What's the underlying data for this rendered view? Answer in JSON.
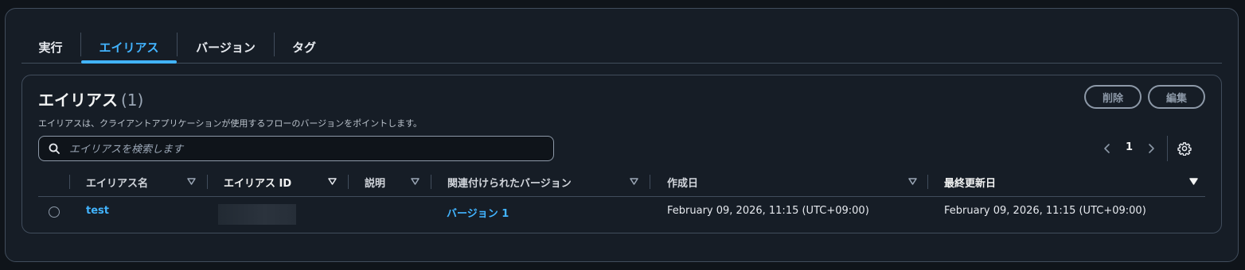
{
  "tabs": [
    {
      "label": "実行",
      "active": false
    },
    {
      "label": "エイリアス",
      "active": true
    },
    {
      "label": "バージョン",
      "active": false
    },
    {
      "label": "タグ",
      "active": false
    }
  ],
  "panel": {
    "title": "エイリアス",
    "count": "(1)",
    "description": "エイリアスは、クライアントアプリケーションが使用するフローのバージョンをポイントします。",
    "delete_label": "削除",
    "edit_label": "編集"
  },
  "search": {
    "placeholder": "エイリアスを検索します",
    "value": ""
  },
  "pagination": {
    "current_page": "1"
  },
  "table": {
    "columns": [
      "エイリアス名",
      "エイリアス ID",
      "説明",
      "関連付けられたバージョン",
      "作成日",
      "最終更新日"
    ],
    "rows": [
      {
        "name": "test",
        "alias_id": "",
        "description": "",
        "version": "バージョン 1",
        "created": "February 09, 2026, 11:15 (UTC+09:00)",
        "updated": "February 09, 2026, 11:15 (UTC+09:00)"
      }
    ]
  },
  "colors": {
    "accent": "#42b4ff",
    "background": "#0f141a",
    "panel": "#161d26",
    "border": "#414d5c"
  }
}
